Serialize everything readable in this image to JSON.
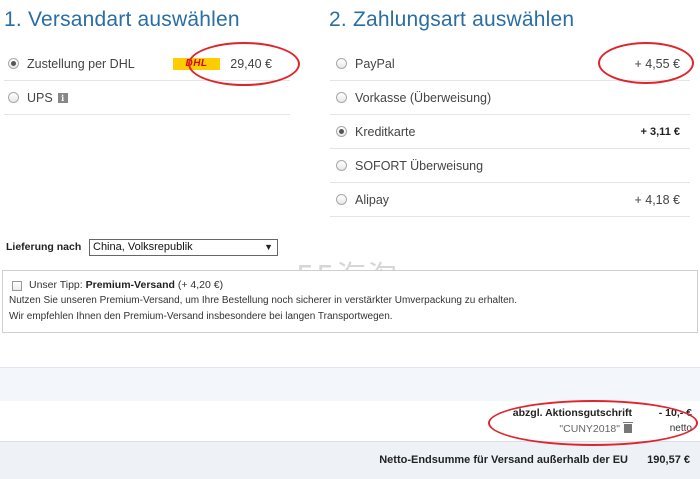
{
  "shipping": {
    "heading": "1. Versandart auswählen",
    "options": [
      {
        "label": "Zustellung per DHL",
        "price": "29,40 €",
        "selected": true,
        "logo": "DHL"
      },
      {
        "label": "UPS",
        "price": "",
        "selected": false,
        "icon": "info-icon"
      }
    ]
  },
  "payment": {
    "heading": "2. Zahlungsart auswählen",
    "options": [
      {
        "label": "PayPal",
        "price": "+ 4,55 €",
        "selected": false
      },
      {
        "label": "Vorkasse (Überweisung)",
        "price": "",
        "selected": false
      },
      {
        "label": "Kreditkarte",
        "price": "+ 3,11 €",
        "selected": true
      },
      {
        "label": "SOFORT Überweisung",
        "price": "",
        "selected": false
      },
      {
        "label": "Alipay",
        "price": "+ 4,18 €",
        "selected": false
      }
    ]
  },
  "delivery": {
    "label": "Lieferung nach",
    "selected_country": "China, Volksrepublik"
  },
  "tip": {
    "prefix": "Unser Tipp:",
    "product": "Premium-Versand",
    "price_note": "(+ 4,20 €)",
    "line2": "Nutzen Sie unseren Premium-Versand, um Ihre Bestellung noch sicherer in verstärkter Umverpackung zu erhalten.",
    "line3": "Wir empfehlen Ihnen den Premium-Versand insbesondere bei langen Transportwegen."
  },
  "watermark": "55海淘",
  "summary": {
    "credit_label": "abzgl. Aktionsgutschrift",
    "credit_value": "- 10,- €",
    "coupon_code": "\"CUNY2018\"",
    "netto_label": "netto",
    "total_label": "Netto-Endsumme für Versand außerhalb der EU",
    "total_value": "190,57 €"
  },
  "colors": {
    "heading_blue": "#2a6ea6",
    "annotation_red": "#e0242c",
    "dhl_yellow": "#ffcc00",
    "dhl_red": "#d40511"
  }
}
